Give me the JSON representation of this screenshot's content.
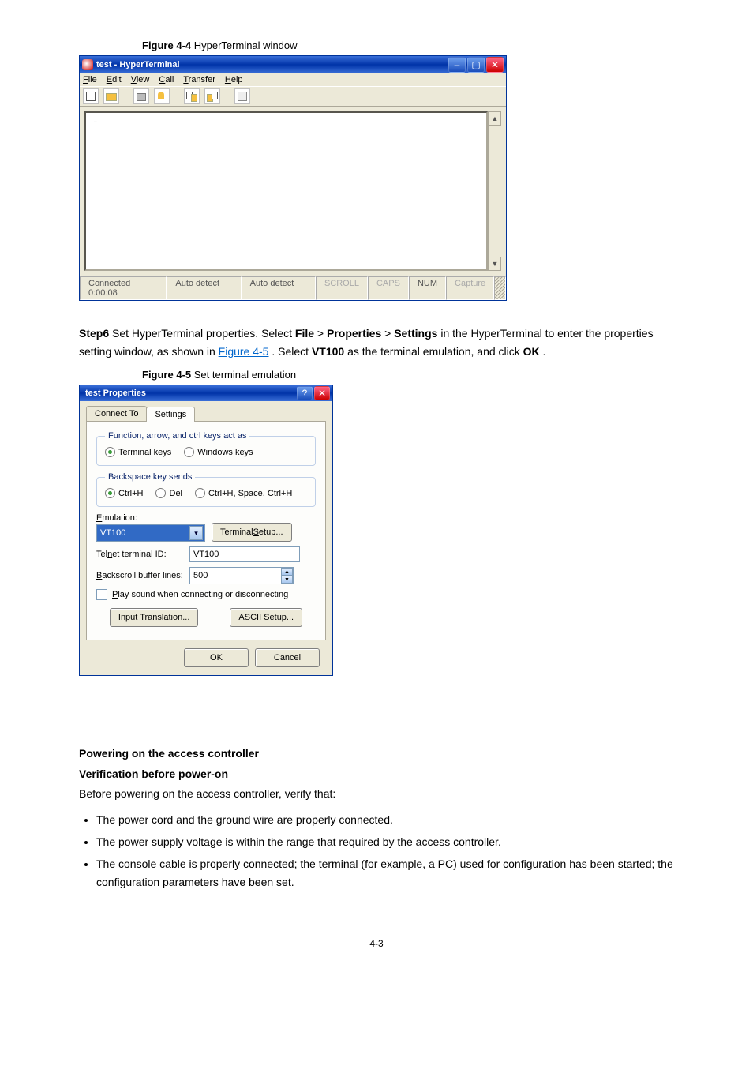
{
  "figure1": {
    "prefix": "Figure 4-4",
    "caption": "HyperTerminal window"
  },
  "ht": {
    "title": "test - HyperTerminal",
    "menu": {
      "file": "File",
      "edit": "Edit",
      "view": "View",
      "call": "Call",
      "transfer": "Transfer",
      "help": "Help"
    },
    "terminal_content": "-",
    "status": {
      "connected": "Connected 0:00:08",
      "autodetect1": "Auto detect",
      "autodetect2": "Auto detect",
      "scroll": "SCROLL",
      "caps": "CAPS",
      "num": "NUM",
      "capture": "Capture"
    }
  },
  "step6": {
    "prefix": "Step6",
    "text1": "Set HyperTerminal properties. Select ",
    "seq_file": "File",
    "gt1": " > ",
    "seq_prop": "Properties",
    "gt2": " > ",
    "seq_set": "Settings",
    "text2": " in the HyperTerminal to enter the properties setting window, as shown in ",
    "figlink": "Figure 4-5",
    "text3": ". Select ",
    "vt": "VT100",
    "text4": " as the terminal emulation, and click ",
    "ok": "OK",
    "text5": "."
  },
  "figure2": {
    "prefix": "Figure 4-5",
    "caption": "Set terminal emulation"
  },
  "dlg": {
    "title": "test Properties",
    "tab1": "Connect To",
    "tab2": "Settings",
    "grp1": "Function, arrow, and ctrl keys act as",
    "opt_terminal": "Terminal keys",
    "opt_windows": "Windows keys",
    "grp2": "Backspace key sends",
    "opt_ctrlh": "Ctrl+H",
    "opt_del": "Del",
    "opt_ctrlhsp": "Ctrl+H, Space, Ctrl+H",
    "emulation_label": "Emulation:",
    "emulation_value": "VT100",
    "term_setup": "Terminal Setup...",
    "telnet_label": "Telnet terminal ID:",
    "telnet_value": "VT100",
    "backscroll_label": "Backscroll buffer lines:",
    "backscroll_value": "500",
    "play_sound": "Play sound when connecting or disconnecting",
    "input_trans": "Input Translation...",
    "ascii_setup": "ASCII Setup...",
    "ok": "OK",
    "cancel": "Cancel"
  },
  "power": {
    "heading": "Powering on the access controller",
    "verify_heading": "Verification before power-on",
    "intro": "Before powering on the access controller, verify that:",
    "b1": "The power cord and the ground wire are properly connected.",
    "b2": "The power supply voltage is within the range that required by the access controller.",
    "b3": "The console cable is properly connected; the terminal (for example, a PC) used for configuration has been started; the configuration parameters have been set."
  },
  "pagenum": "4-3"
}
